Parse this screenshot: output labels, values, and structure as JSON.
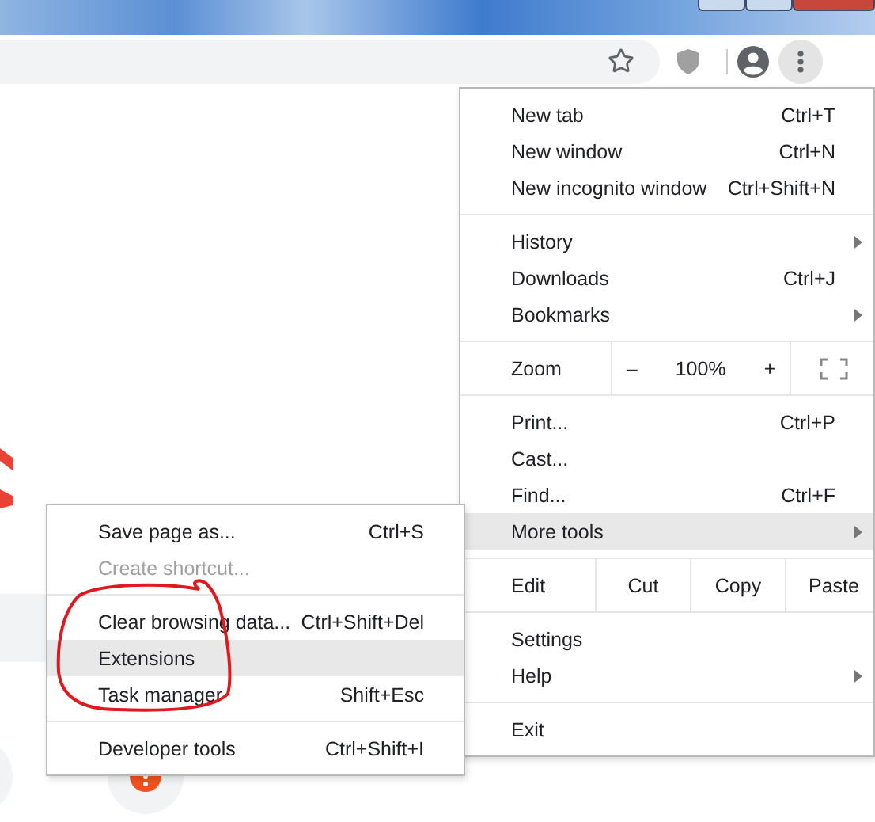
{
  "main_menu": {
    "sections": [
      [
        {
          "kind": "item",
          "label": "New tab",
          "shortcut": "Ctrl+T",
          "submenu": false,
          "selected": false
        },
        {
          "kind": "item",
          "label": "New window",
          "shortcut": "Ctrl+N",
          "submenu": false,
          "selected": false
        },
        {
          "kind": "item",
          "label": "New incognito window",
          "shortcut": "Ctrl+Shift+N",
          "submenu": false,
          "selected": false
        }
      ],
      [
        {
          "kind": "item",
          "label": "History",
          "submenu": true,
          "selected": false
        },
        {
          "kind": "item",
          "label": "Downloads",
          "shortcut": "Ctrl+J",
          "submenu": false,
          "selected": false
        },
        {
          "kind": "item",
          "label": "Bookmarks",
          "submenu": true,
          "selected": false
        }
      ],
      [
        {
          "kind": "zoom",
          "label": "Zoom",
          "minus": "–",
          "value": "100%",
          "plus": "+"
        }
      ],
      [
        {
          "kind": "item",
          "label": "Print...",
          "shortcut": "Ctrl+P",
          "submenu": false,
          "selected": false
        },
        {
          "kind": "item",
          "label": "Cast...",
          "submenu": false,
          "selected": false
        },
        {
          "kind": "item",
          "label": "Find...",
          "shortcut": "Ctrl+F",
          "submenu": false,
          "selected": false
        },
        {
          "kind": "item",
          "label": "More tools",
          "submenu": true,
          "selected": true
        }
      ],
      [
        {
          "kind": "edit",
          "label": "Edit",
          "buttons": [
            "Cut",
            "Copy",
            "Paste"
          ]
        }
      ],
      [
        {
          "kind": "item",
          "label": "Settings",
          "submenu": false,
          "selected": false
        },
        {
          "kind": "item",
          "label": "Help",
          "submenu": true,
          "selected": false
        }
      ],
      [
        {
          "kind": "item",
          "label": "Exit",
          "submenu": false,
          "selected": false
        }
      ]
    ]
  },
  "more_tools_menu": {
    "sections": [
      [
        {
          "label": "Save page as...",
          "shortcut": "Ctrl+S",
          "disabled": false,
          "selected": false
        },
        {
          "label": "Create shortcut...",
          "disabled": true,
          "selected": false
        }
      ],
      [
        {
          "label": "Clear browsing data...",
          "shortcut": "Ctrl+Shift+Del",
          "disabled": false,
          "selected": false
        },
        {
          "label": "Extensions",
          "disabled": false,
          "selected": true
        },
        {
          "label": "Task manager",
          "shortcut": "Shift+Esc",
          "disabled": false,
          "selected": false
        }
      ],
      [
        {
          "label": "Developer tools",
          "shortcut": "Ctrl+Shift+I",
          "disabled": false,
          "selected": false
        }
      ]
    ]
  }
}
